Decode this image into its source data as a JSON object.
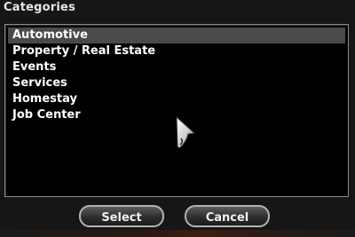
{
  "window": {
    "title": "Categories"
  },
  "list": {
    "items": [
      {
        "label": "Automotive",
        "selected": true
      },
      {
        "label": "Property / Real Estate",
        "selected": false
      },
      {
        "label": "Events",
        "selected": false
      },
      {
        "label": "Services",
        "selected": false
      },
      {
        "label": "Homestay",
        "selected": false
      },
      {
        "label": "Job Center",
        "selected": false
      }
    ]
  },
  "buttons": {
    "select_label": "Select",
    "cancel_label": "Cancel"
  },
  "colors": {
    "background": "#161616",
    "list_background": "#000000",
    "selection": "#4a4a4a",
    "text": "#ffffff"
  },
  "icons": {
    "cursor": "arrow-cursor-icon"
  }
}
